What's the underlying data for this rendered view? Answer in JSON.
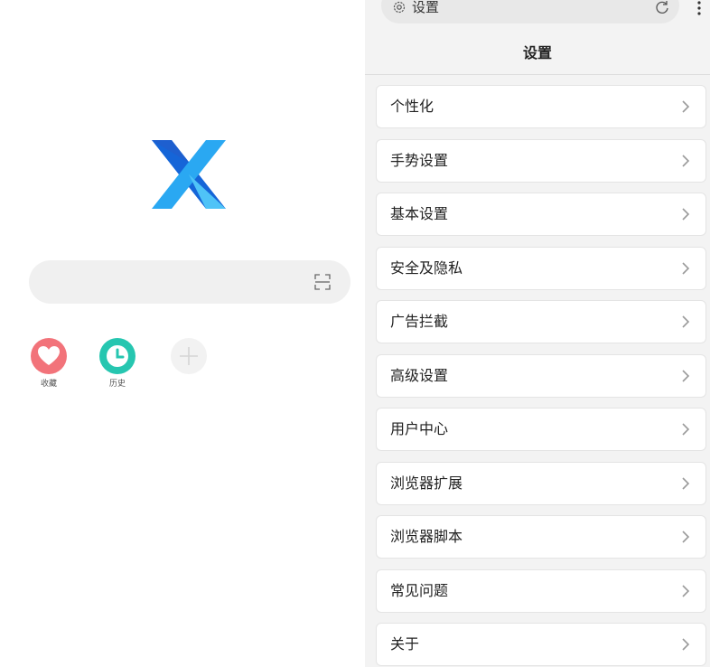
{
  "home": {
    "shortcuts": [
      {
        "label": "收藏",
        "icon": "heart-icon",
        "color": "#f2737a"
      },
      {
        "label": "历史",
        "icon": "clock-icon",
        "color": "#26c6b0"
      },
      {
        "label": "",
        "icon": "plus-icon",
        "color": "#f2f2f2"
      }
    ],
    "logo_colors": [
      "#1e88e5",
      "#29b6f6"
    ]
  },
  "settings": {
    "urlbar_title": "设置",
    "title": "设置",
    "items": [
      {
        "label": "个性化"
      },
      {
        "label": "手势设置"
      },
      {
        "label": "基本设置"
      },
      {
        "label": "安全及隐私"
      },
      {
        "label": "广告拦截"
      },
      {
        "label": "高级设置"
      },
      {
        "label": "用户中心"
      },
      {
        "label": "浏览器扩展"
      },
      {
        "label": "浏览器脚本"
      },
      {
        "label": "常见问题"
      },
      {
        "label": "关于"
      }
    ]
  }
}
